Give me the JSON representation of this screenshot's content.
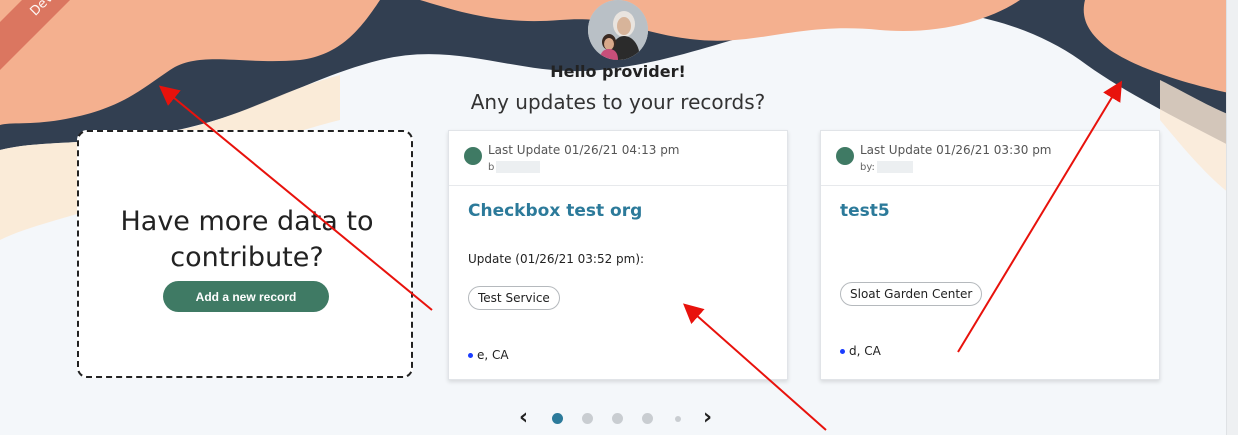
{
  "ribbon_text": "Dev",
  "greeting": "Hello provider!",
  "subtitle": "Any updates to your records?",
  "cta": {
    "title": "Have more data to contribute?",
    "button_label": "Add a new record"
  },
  "cards": [
    {
      "last_update": "Last Update 01/26/21 04:13 pm",
      "by_label": "b",
      "title": "Checkbox test org",
      "update_text": "Update (01/26/21 03:52 pm):",
      "tag": "Test Service",
      "location": "e, CA"
    },
    {
      "last_update": "Last Update 01/26/21 03:30 pm",
      "by_label": "by:",
      "title": "test5",
      "update_text": "",
      "tag": "Sloat Garden Center",
      "location": "d, CA"
    }
  ],
  "pager": {
    "prev_icon": "chevron-left-icon",
    "next_icon": "chevron-right-icon",
    "prev_glyph": "‹",
    "next_glyph": "›",
    "dots": 5,
    "active_index": 0
  },
  "colors": {
    "brand_green": "#3f7a64",
    "title_blue": "#2c7a9a",
    "peach": "#f4b08f",
    "navy": "#323f51",
    "cream": "#fbe9d4",
    "annotation_red": "#e8120c"
  }
}
